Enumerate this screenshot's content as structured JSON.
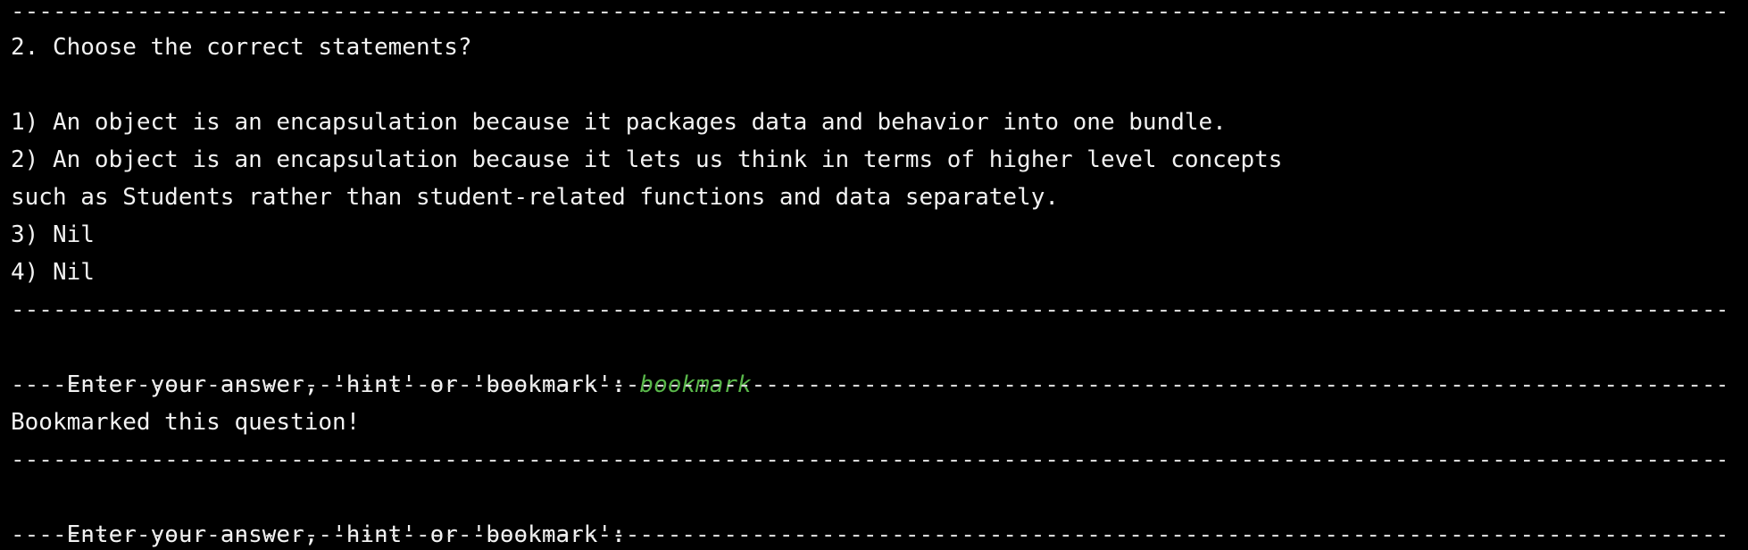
{
  "terminal": {
    "separator": "-------------------------------------------------------------------------------------------------------------------------------------------------------------------------------------------------------------------",
    "question_title": "2. Choose the correct statements?",
    "options": [
      "1) An object is an encapsulation because it packages data and behavior into one bundle.",
      "2) An object is an encapsulation because it lets us think in terms of higher level concepts",
      "such as Students rather than student-related functions and data separately.",
      "3) Nil",
      "4) Nil"
    ],
    "prompt_1": "Enter your answer, 'hint' or 'bookmark': ",
    "user_input_1": "bookmark",
    "response": "Bookmarked this question!",
    "prompt_2": "Enter your answer, 'hint' or 'bookmark':"
  },
  "colors": {
    "background": "#000000",
    "text": "#f2f2f2",
    "user_input": "#59b84a"
  }
}
